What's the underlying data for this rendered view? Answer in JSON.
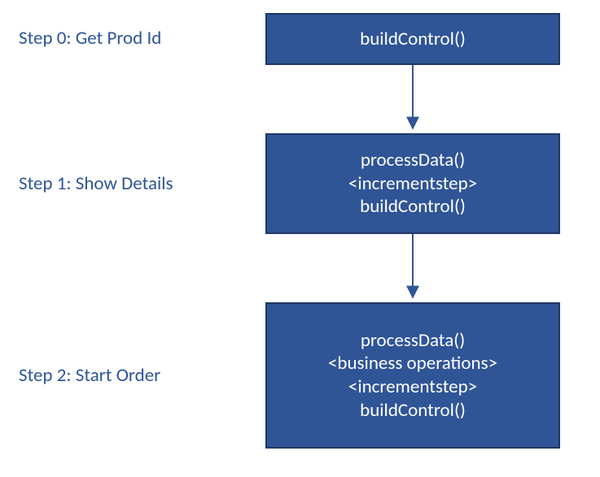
{
  "colors": {
    "accent": "#2f5597",
    "border": "#203864",
    "node_text": "#ffffff",
    "label_text": "#2f5597"
  },
  "steps": [
    {
      "label": "Step 0: Get Prod Id",
      "lines": [
        "buildControl()"
      ]
    },
    {
      "label": "Step 1: Show Details",
      "lines": [
        "processData()",
        "<incrementstep>",
        "buildControl()"
      ]
    },
    {
      "label": "Step 2: Start Order",
      "lines": [
        "processData()",
        "<business operations>",
        "<incrementstep>",
        "buildControl()"
      ]
    }
  ]
}
